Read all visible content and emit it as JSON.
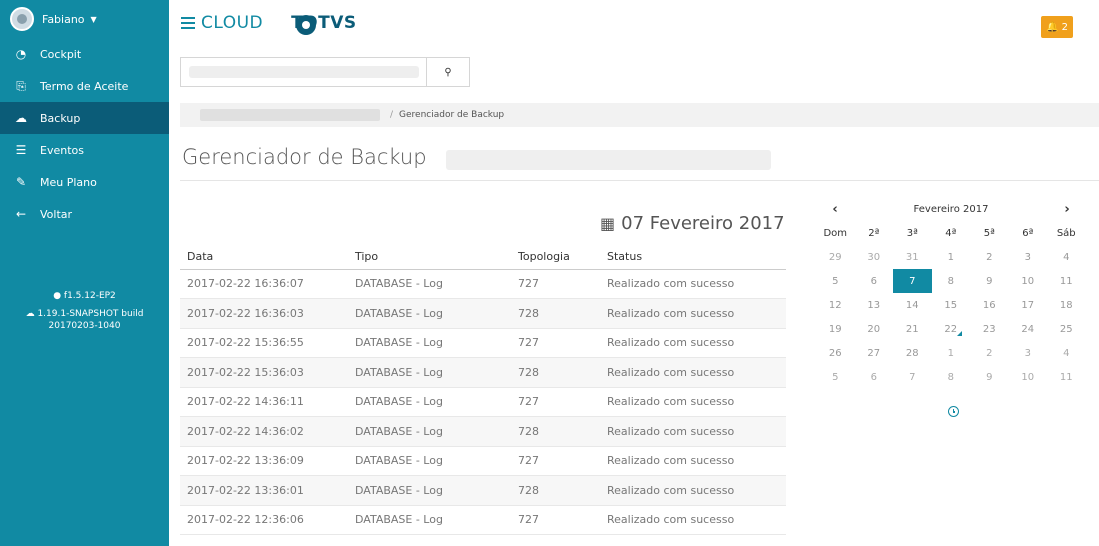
{
  "sidebar": {
    "user": "Fabiano",
    "items": [
      {
        "label": "Cockpit",
        "icon": "dashboard-icon"
      },
      {
        "label": "Termo de Aceite",
        "icon": "document-icon"
      },
      {
        "label": "Backup",
        "icon": "cloud-upload-icon",
        "active": true
      },
      {
        "label": "Eventos",
        "icon": "list-icon"
      },
      {
        "label": "Meu Plano",
        "icon": "edit-icon"
      },
      {
        "label": "Voltar",
        "icon": "arrow-left-icon"
      }
    ],
    "version1": "f1.5.12-EP2",
    "version2_line1": "1.19.1-SNAPSHOT build",
    "version2_line2": "20170203-1040"
  },
  "header": {
    "brand_cloud": "CLOUD",
    "brand_totvs": "TOTVS",
    "notifications": "2"
  },
  "breadcrumb": {
    "separator": "/",
    "current": "Gerenciador de Backup"
  },
  "page": {
    "title": "Gerenciador de Backup",
    "selected_date": "07 Fevereiro 2017"
  },
  "table": {
    "headers": [
      "Data",
      "Tipo",
      "Topologia",
      "Status"
    ],
    "rows": [
      [
        "2017-02-22 16:36:07",
        "DATABASE - Log",
        "727",
        "Realizado com sucesso"
      ],
      [
        "2017-02-22 16:36:03",
        "DATABASE - Log",
        "728",
        "Realizado com sucesso"
      ],
      [
        "2017-02-22 15:36:55",
        "DATABASE - Log",
        "727",
        "Realizado com sucesso"
      ],
      [
        "2017-02-22 15:36:03",
        "DATABASE - Log",
        "728",
        "Realizado com sucesso"
      ],
      [
        "2017-02-22 14:36:11",
        "DATABASE - Log",
        "727",
        "Realizado com sucesso"
      ],
      [
        "2017-02-22 14:36:02",
        "DATABASE - Log",
        "728",
        "Realizado com sucesso"
      ],
      [
        "2017-02-22 13:36:09",
        "DATABASE - Log",
        "727",
        "Realizado com sucesso"
      ],
      [
        "2017-02-22 13:36:01",
        "DATABASE - Log",
        "728",
        "Realizado com sucesso"
      ],
      [
        "2017-02-22 12:36:06",
        "DATABASE - Log",
        "727",
        "Realizado com sucesso"
      ]
    ]
  },
  "calendar": {
    "month": "Fevereiro 2017",
    "weekdays": [
      "Dom",
      "2ª",
      "3ª",
      "4ª",
      "5ª",
      "6ª",
      "Sáb"
    ],
    "days": [
      [
        "29",
        "30",
        "31",
        "1",
        "2",
        "3",
        "4"
      ],
      [
        "5",
        "6",
        "7",
        "8",
        "9",
        "10",
        "11"
      ],
      [
        "12",
        "13",
        "14",
        "15",
        "16",
        "17",
        "18"
      ],
      [
        "19",
        "20",
        "21",
        "22",
        "23",
        "24",
        "25"
      ],
      [
        "26",
        "27",
        "28",
        "1",
        "2",
        "3",
        "4"
      ],
      [
        "5",
        "6",
        "7",
        "8",
        "9",
        "10",
        "11"
      ]
    ],
    "selected": "7",
    "marked": "22"
  },
  "colors": {
    "primary": "#118aa3",
    "primary_dark": "#0b5c78",
    "warning": "#f0a01c"
  }
}
